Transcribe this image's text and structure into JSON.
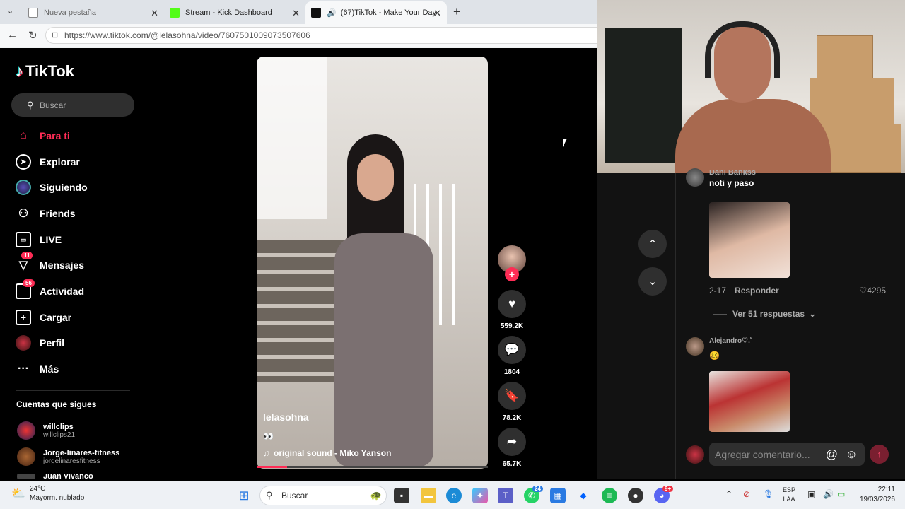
{
  "browser": {
    "tabs": [
      {
        "label": "Nueva pestaña"
      },
      {
        "label": "Stream - Kick Dashboard"
      },
      {
        "label": "(67)TikTok - Make Your Day"
      }
    ],
    "url": "https://www.tiktok.com/@lelasohna/video/7607501009073507606"
  },
  "tiktok": {
    "logo": "TikTok",
    "search_placeholder": "Buscar",
    "nav": [
      {
        "label": "Para ti",
        "icon": "home-icon"
      },
      {
        "label": "Explorar",
        "icon": "compass-icon"
      },
      {
        "label": "Siguiendo",
        "icon": "following-avatar-icon"
      },
      {
        "label": "Friends",
        "icon": "friends-icon"
      },
      {
        "label": "LIVE",
        "icon": "live-tv-icon"
      },
      {
        "label": "Mensajes",
        "icon": "messages-icon",
        "badge": "11"
      },
      {
        "label": "Actividad",
        "icon": "activity-icon",
        "badge": "56"
      },
      {
        "label": "Cargar",
        "icon": "upload-icon"
      },
      {
        "label": "Perfil",
        "icon": "profile-avatar-icon"
      },
      {
        "label": "Más",
        "icon": "more-icon"
      }
    ],
    "following_title": "Cuentas que sigues",
    "following": [
      {
        "name": "willclips",
        "handle": "willclips21"
      },
      {
        "name": "Jorge-linares-fitness",
        "handle": "jorgelinaresfitness"
      },
      {
        "name": "Juan Vivanco",
        "handle": ""
      }
    ],
    "video": {
      "author": "lelasohna",
      "caption_emoji": "👀",
      "sound": "original sound - Miko Yanson",
      "progress": 0.13
    },
    "actions": {
      "likes": "559.2K",
      "comments": "1804",
      "saves": "78.2K",
      "shares": "65.7K"
    },
    "comments": [
      {
        "name": "Dani Bankss",
        "text": "noti y paso",
        "date": "2-17",
        "reply": "Responder",
        "likes": "4295",
        "view_replies": "Ver 51 respuestas"
      },
      {
        "name": "Alejandro♡.˚",
        "text": "🥴"
      }
    ],
    "comment_placeholder": "Agregar comentario...",
    "accent": "#fe2c55"
  },
  "taskbar": {
    "temperature": "24°C",
    "weather": "Mayorm. nublado",
    "search": "Buscar",
    "lang_top": "ESP",
    "lang_bottom": "LAA",
    "time": "22:11",
    "date": "19/03/2026",
    "whatsapp_badge": "24",
    "discord_badge": "9+"
  }
}
